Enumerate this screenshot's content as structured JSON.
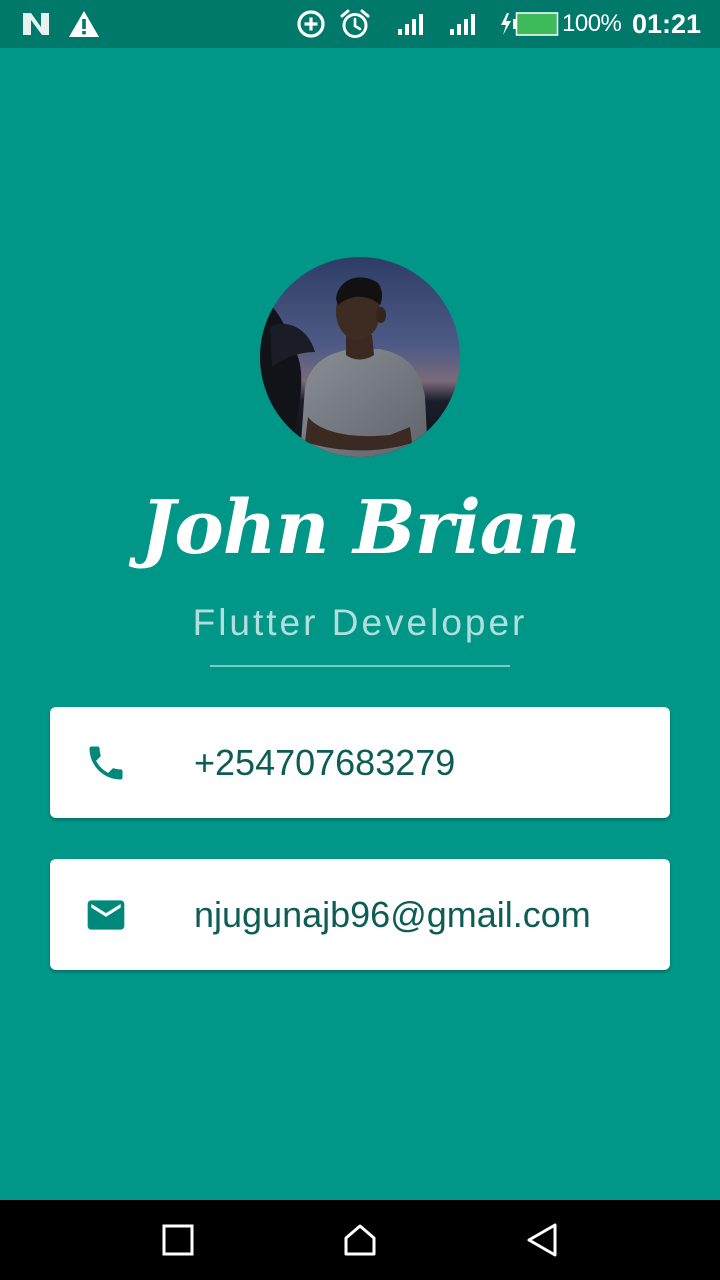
{
  "status_bar": {
    "background": "#00796B",
    "icons": [
      "n-notification-icon",
      "warning-icon",
      "data-saver-icon",
      "alarm-icon",
      "signal-sim1-icon",
      "signal-sim2-icon",
      "battery-charging-icon"
    ],
    "battery_percent": "100%",
    "time": "01:21"
  },
  "profile": {
    "avatar": "profile-photo",
    "name": "John Brian",
    "title": "Flutter Developer"
  },
  "contacts": {
    "phone": {
      "icon": "phone-icon",
      "value": "+254707683279"
    },
    "email": {
      "icon": "email-icon",
      "value": "njugunajb96@gmail.com"
    }
  },
  "nav_bar": {
    "buttons": [
      "recents-button",
      "home-button",
      "back-button"
    ]
  },
  "colors": {
    "background": "#009688",
    "card": "#FFFFFF",
    "card_text": "#0D5C55",
    "icon_accent": "#00897B",
    "subtitle": "#B2DFDB"
  }
}
